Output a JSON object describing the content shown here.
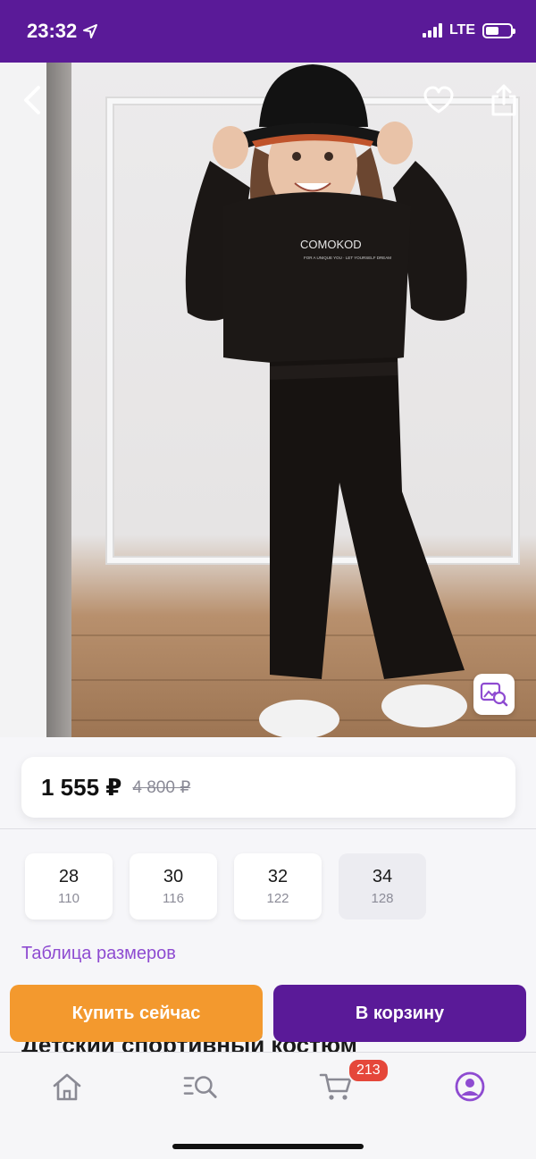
{
  "status_bar": {
    "time": "23:32",
    "network": "LTE",
    "background": "#5a1a98"
  },
  "photo": {
    "icons": [
      "back-chevron-icon",
      "heart-icon",
      "share-icon",
      "visual-search-icon"
    ],
    "print_text": "COMOKOD",
    "print_subtext": "FOR A UNIQUE YOU · LET YOURSELF DREAM"
  },
  "price": {
    "current": "1 555 ₽",
    "old": "4 800 ₽"
  },
  "sizes": [
    {
      "size": "28",
      "height": "110",
      "available": true
    },
    {
      "size": "30",
      "height": "116",
      "available": true
    },
    {
      "size": "32",
      "height": "122",
      "available": true
    },
    {
      "size": "34",
      "height": "128",
      "available": false
    }
  ],
  "size_table_link": "Таблица размеров",
  "product_title": "Детский спортивный костюм",
  "actions": {
    "buy_now": "Купить сейчас",
    "add_to_cart": "В корзину"
  },
  "tab_bar": {
    "tabs": [
      "home-icon",
      "catalog-search-icon",
      "cart-icon",
      "profile-icon"
    ],
    "cart_badge": "213",
    "active_color": "#8e4bd1"
  },
  "colors": {
    "accent": "#5a1a98",
    "buy": "#f3992e",
    "link": "#8e4bd1",
    "badge": "#e5473a"
  }
}
